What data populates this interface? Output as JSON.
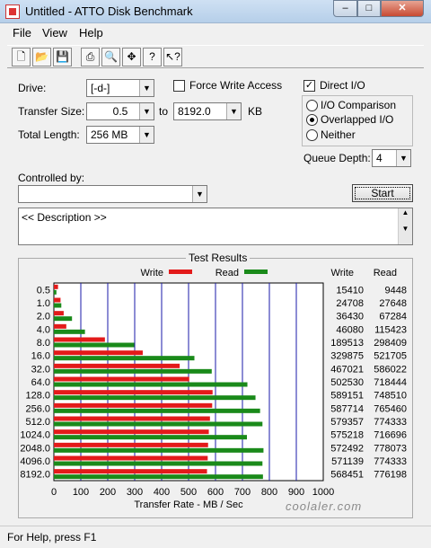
{
  "window": {
    "title": "Untitled - ATTO Disk Benchmark"
  },
  "menu": [
    "File",
    "View",
    "Help"
  ],
  "toolbar": {
    "icons": [
      "new-icon",
      "open-icon",
      "save-icon",
      "print-icon",
      "print-preview-icon",
      "move-icon",
      "help-icon",
      "context-help-icon"
    ]
  },
  "form": {
    "drive_label": "Drive:",
    "drive_value": "[-d-]",
    "force_write_label": "Force Write Access",
    "force_write_checked": false,
    "direct_io_label": "Direct I/O",
    "direct_io_checked": true,
    "transfer_size_label": "Transfer Size:",
    "transfer_from": "0.5",
    "to_label": "to",
    "transfer_to": "8192.0",
    "kb_label": "KB",
    "total_length_label": "Total Length:",
    "total_length_value": "256 MB",
    "io_options": [
      "I/O Comparison",
      "Overlapped I/O",
      "Neither"
    ],
    "io_selected": 1,
    "queue_depth_label": "Queue Depth:",
    "queue_depth_value": "4",
    "controlled_by_label": "Controlled by:",
    "controlled_by_value": "",
    "start_label": "Start",
    "description": "<< Description >>"
  },
  "results": {
    "title": "Test Results",
    "legend_write": "Write",
    "legend_read": "Read",
    "col_write": "Write",
    "col_read": "Read",
    "write_values": [
      "15410",
      "24708",
      "36430",
      "46080",
      "189513",
      "329875",
      "467021",
      "502530",
      "589151",
      "587714",
      "579357",
      "575218",
      "572492",
      "571139",
      "568451"
    ],
    "read_values": [
      "9448",
      "27648",
      "67284",
      "115423",
      "298409",
      "521705",
      "586022",
      "718444",
      "748510",
      "765460",
      "774333",
      "716696",
      "778073",
      "774333",
      "776198"
    ]
  },
  "chart_data": {
    "type": "bar",
    "orientation": "horizontal",
    "title": "Test Results",
    "xlabel": "Transfer Rate - MB / Sec",
    "ylabel": "",
    "categories": [
      "0.5",
      "1.0",
      "2.0",
      "4.0",
      "8.0",
      "16.0",
      "32.0",
      "64.0",
      "128.0",
      "256.0",
      "512.0",
      "1024.0",
      "2048.0",
      "4096.0",
      "8192.0"
    ],
    "series": [
      {
        "name": "Write",
        "color": "#e31a1a",
        "values": [
          15.4,
          24.7,
          36.4,
          46.1,
          189.5,
          329.9,
          467.0,
          502.5,
          589.2,
          587.7,
          579.4,
          575.2,
          572.5,
          571.1,
          568.5
        ]
      },
      {
        "name": "Read",
        "color": "#1a8a1a",
        "values": [
          9.4,
          27.6,
          67.3,
          115.4,
          298.4,
          521.7,
          586.0,
          718.4,
          748.5,
          765.5,
          774.3,
          716.7,
          778.1,
          774.3,
          776.2
        ]
      }
    ],
    "xlim": [
      0,
      1000
    ],
    "xticks": [
      "0",
      "100",
      "200",
      "300",
      "400",
      "500",
      "600",
      "700",
      "800",
      "900",
      "1000"
    ],
    "grid": true,
    "legend": "top"
  },
  "status": {
    "text": "For Help, press F1"
  },
  "watermark": "coolaler.com"
}
